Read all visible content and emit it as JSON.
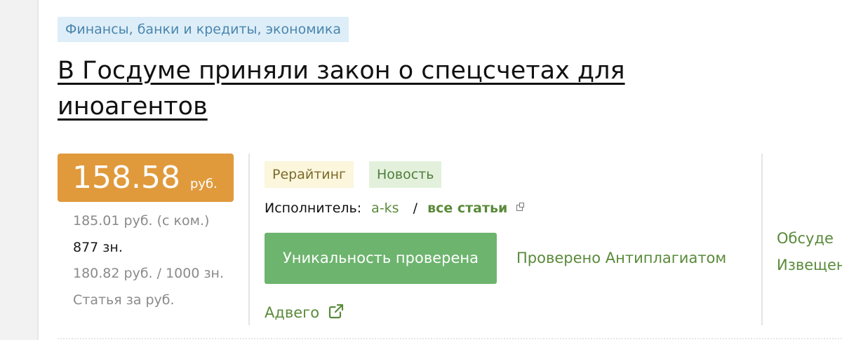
{
  "article": {
    "category": "Финансы, банки и кредиты, экономика",
    "title": "В Госдуме приняли закон о спецсчетах для иноагентов"
  },
  "price": {
    "value": "158.58",
    "unit": "руб.",
    "with_commission": "185.01 руб. (с ком.)",
    "chars": "877 зн.",
    "per_thousand": "180.82 руб. / 1000 зн.",
    "article_for": "Статья за руб."
  },
  "tags": {
    "rewrite": "Рерайтинг",
    "news": "Новость"
  },
  "performer": {
    "label": "Исполнитель:",
    "name": "a-ks",
    "separator": "/",
    "all_articles": "все статьи"
  },
  "uniqueness": {
    "button_label": "Уникальность проверена",
    "antiplagiat": "Проверено Антиплагиатом",
    "advego": "Адвего"
  },
  "side": {
    "discuss": "Обсуде",
    "notify": "Извещен"
  },
  "colors": {
    "price_bg": "#e09a3c",
    "button_bg": "#6db46e",
    "link": "#5a8a3a",
    "category_bg": "#deeef8"
  },
  "icons": {
    "all_articles": "external-window-icon",
    "advego": "external-link-icon"
  }
}
